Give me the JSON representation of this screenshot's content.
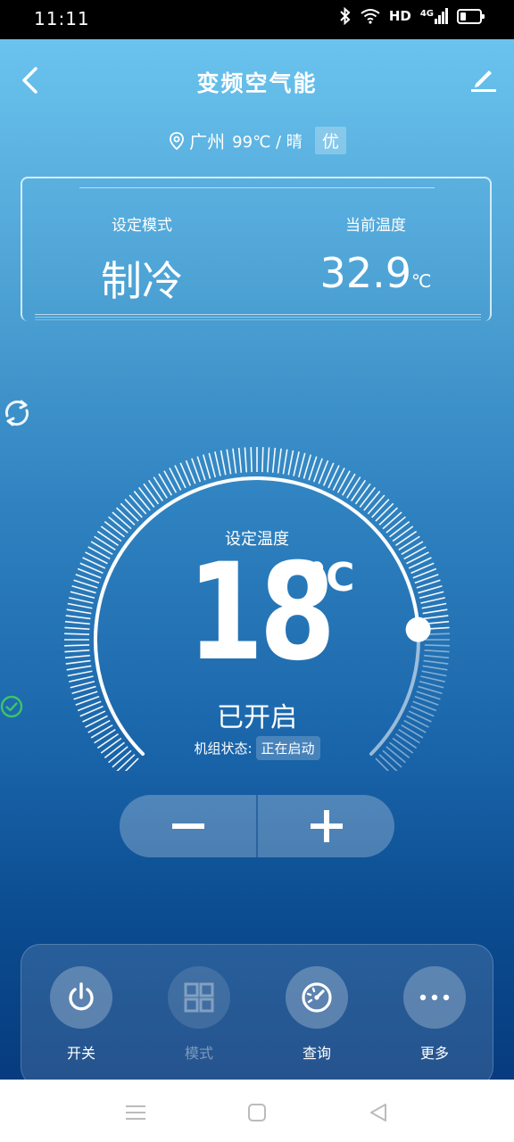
{
  "status_bar": {
    "time": "11:11",
    "hd": "HD",
    "network": "4G"
  },
  "header": {
    "title": "变频空气能"
  },
  "weather": {
    "city": "广州",
    "temp": "99℃ / 晴",
    "aqi": "优"
  },
  "info": {
    "mode_label": "设定模式",
    "mode_value": "制冷",
    "current_temp_label": "当前温度",
    "current_temp_value": "32.9",
    "current_temp_unit": "℃"
  },
  "dial": {
    "set_label": "设定温度",
    "set_value": "18",
    "unit": "℃",
    "power_status": "已开启",
    "unit_status_label": "机组状态:",
    "unit_status_value": "正在启动",
    "knob_level": 0.82
  },
  "stepper": {
    "minus": "−",
    "plus": "+"
  },
  "bottom_menu": [
    {
      "label": "开关",
      "icon": "power-icon",
      "enabled": true
    },
    {
      "label": "模式",
      "icon": "grid-icon",
      "enabled": false
    },
    {
      "label": "查询",
      "icon": "gauge-icon",
      "enabled": true
    },
    {
      "label": "更多",
      "icon": "more-icon",
      "enabled": true
    }
  ],
  "colors": {
    "accent_green": "#3cc46a",
    "bg_top": "#6ac3ee",
    "bg_bottom": "#073c7f"
  }
}
